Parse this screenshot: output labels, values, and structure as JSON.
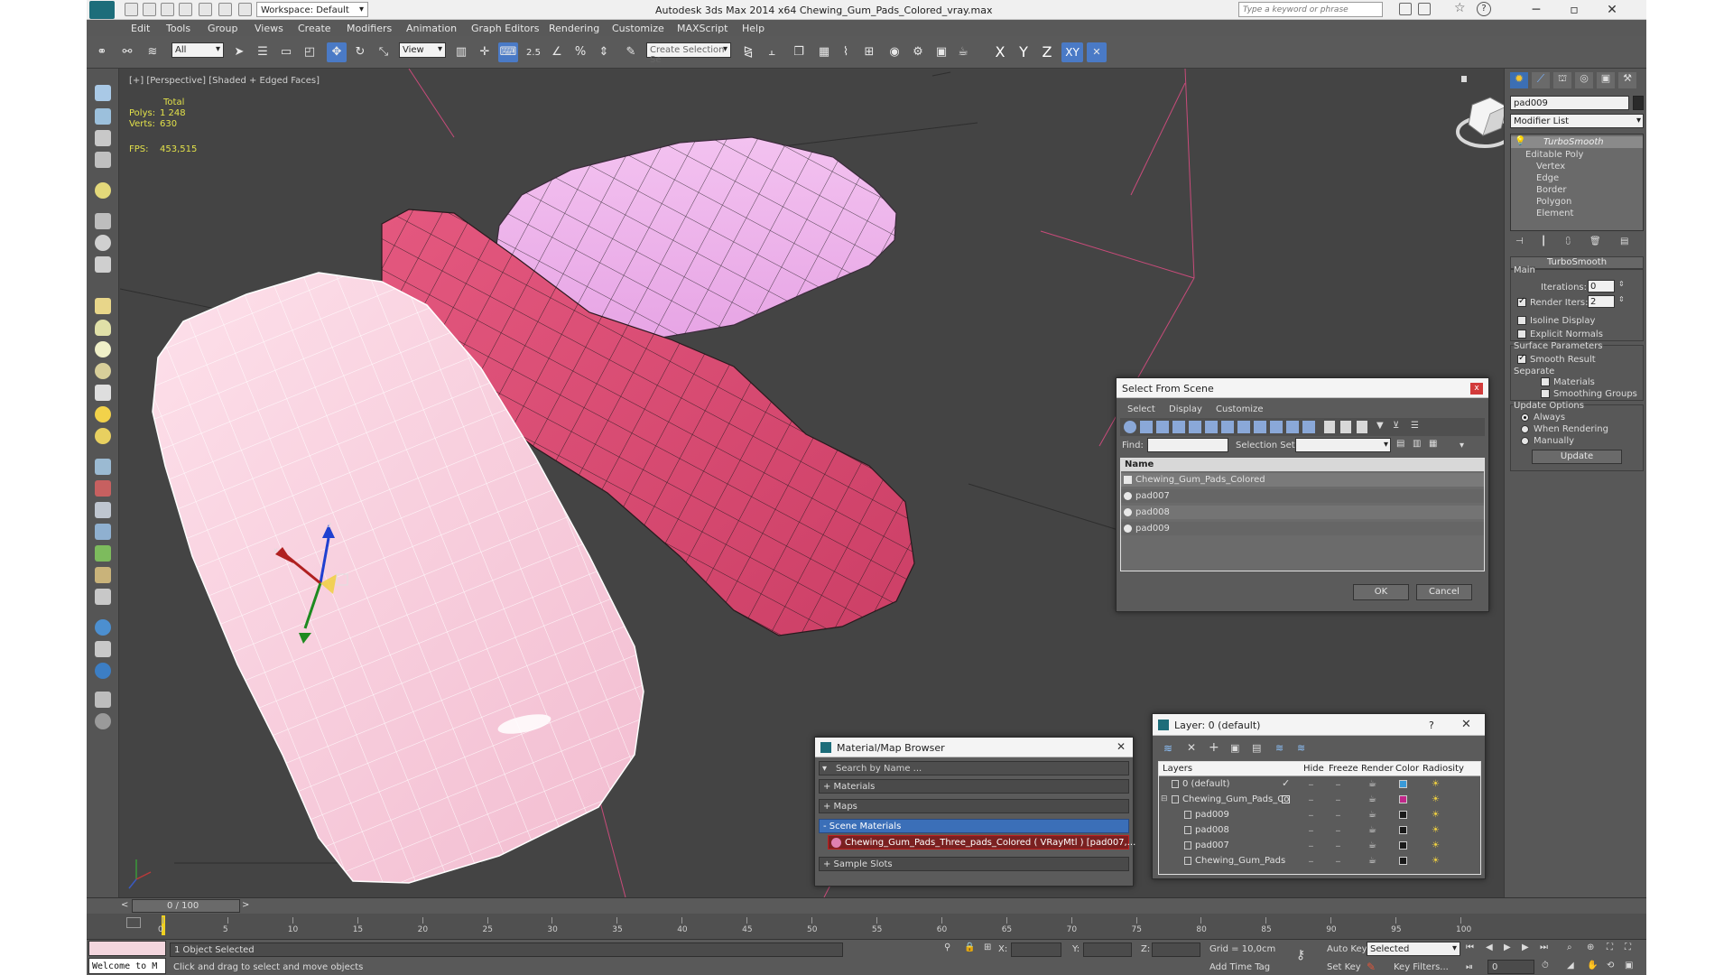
{
  "titlebar": {
    "title": "Autodesk 3ds Max  2014 x64     Chewing_Gum_Pads_Colored_vray.max",
    "workspace": "Workspace: Default",
    "search_placeholder": "Type a keyword or phrase"
  },
  "menu": [
    "Edit",
    "Tools",
    "Group",
    "Views",
    "Create",
    "Modifiers",
    "Animation",
    "Graph Editors",
    "Rendering",
    "Customize",
    "MAXScript",
    "Help"
  ],
  "toolbar": {
    "filter": "All",
    "refcoord": "View",
    "snap_angle": "2.5",
    "selection_set_placeholder": "Create Selection Se",
    "axes": [
      "X",
      "Y",
      "Z",
      "XY"
    ],
    "accent": "#4a7ac6"
  },
  "viewport": {
    "label": "[+] [Perspective] [Shaded + Edged Faces]",
    "stats": {
      "total_label": "Total",
      "polys_label": "Polys:",
      "polys": "1 248",
      "verts_label": "Verts:",
      "verts": "630",
      "fps_label": "FPS:",
      "fps": "453,515"
    },
    "gizmo": {
      "z": "z",
      "x": "x"
    }
  },
  "command_panel": {
    "object_name": "pad009",
    "modifier_list": "Modifier List",
    "stack": [
      "TurboSmooth",
      "Editable Poly",
      "Vertex",
      "Edge",
      "Border",
      "Polygon",
      "Element"
    ],
    "turbosmooth": {
      "title": "TurboSmooth",
      "main": "Main",
      "iterations_label": "Iterations:",
      "iterations": "0",
      "render_iters_label": "Render Iters:",
      "render_iters": "2",
      "isoline": "Isoline Display",
      "explicit": "Explicit Normals",
      "surface": "Surface Parameters",
      "smooth": "Smooth Result",
      "separate": "Separate",
      "materials": "Materials",
      "smoothing": "Smoothing Groups",
      "update_opts": "Update Options",
      "always": "Always",
      "when_render": "When Rendering",
      "manually": "Manually",
      "update_btn": "Update"
    }
  },
  "select_scene": {
    "title": "Select From Scene",
    "close": "x",
    "menu": [
      "Select",
      "Display",
      "Customize"
    ],
    "find_label": "Find:",
    "selset_label": "Selection Set:",
    "col_name": "Name",
    "items": [
      "Chewing_Gum_Pads_Colored",
      "pad007",
      "pad008",
      "pad009"
    ],
    "ok": "OK",
    "cancel": "Cancel"
  },
  "mat_browser": {
    "title": "Material/Map Browser",
    "search_placeholder": "Search by Name ...",
    "groups": [
      "+ Materials",
      "+ Maps",
      "- Scene Materials"
    ],
    "item": "Chewing_Gum_Pads_Three_pads_Colored ( VRayMtl ) [pad007,...",
    "sample": "+ Sample Slots"
  },
  "layer_dialog": {
    "title": "Layer: 0 (default)",
    "help": "?",
    "cols": [
      "Layers",
      "Hide",
      "Freeze",
      "Render",
      "Color",
      "Radiosity"
    ],
    "rows": [
      {
        "name": "0 (default)",
        "color": "#3a9ad8"
      },
      {
        "name": "Chewing_Gum_Pads_Co",
        "color": "#c0288a"
      },
      {
        "name": "pad009",
        "color": "#1a1a1a"
      },
      {
        "name": "pad008",
        "color": "#1a1a1a"
      },
      {
        "name": "pad007",
        "color": "#1a1a1a"
      },
      {
        "name": "Chewing_Gum_Pads",
        "color": "#1a1a1a"
      }
    ]
  },
  "timeline": {
    "frame": "0 / 100",
    "ticks": [
      "0",
      "5",
      "10",
      "15",
      "20",
      "25",
      "30",
      "35",
      "40",
      "45",
      "50",
      "55",
      "60",
      "65",
      "70",
      "75",
      "80",
      "85",
      "90",
      "95",
      "100"
    ]
  },
  "status": {
    "maxscript": "Welcome to M",
    "selected": "1 Object Selected",
    "prompt": "Click and drag to select and move objects",
    "x_label": "X:",
    "y_label": "Y:",
    "z_label": "Z:",
    "grid": "Grid = 10,0cm",
    "autokey": "Auto Key",
    "setkey": "Set Key",
    "selected_drop": "Selected",
    "keyfilters": "Key Filters...",
    "addtimetag": "Add Time Tag",
    "frame_field": "0"
  }
}
